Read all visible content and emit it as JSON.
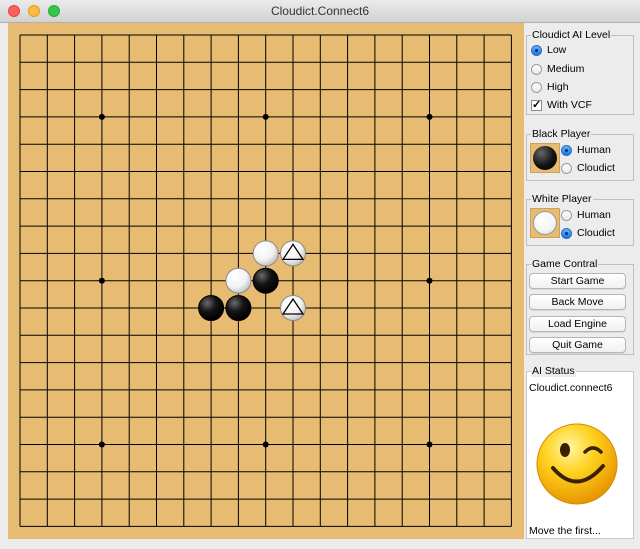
{
  "window": {
    "title": "Cloudict.Connect6"
  },
  "board": {
    "grid_size": 19,
    "star_points": [
      [
        3,
        3
      ],
      [
        9,
        3
      ],
      [
        15,
        3
      ],
      [
        3,
        9
      ],
      [
        15,
        9
      ],
      [
        3,
        15
      ],
      [
        9,
        15
      ],
      [
        15,
        15
      ]
    ],
    "stones": [
      {
        "col": 9,
        "row": 8,
        "color": "white",
        "marker": ""
      },
      {
        "col": 10,
        "row": 8,
        "color": "white",
        "marker": "triangle"
      },
      {
        "col": 8,
        "row": 9,
        "color": "white",
        "marker": ""
      },
      {
        "col": 9,
        "row": 9,
        "color": "black",
        "marker": ""
      },
      {
        "col": 7,
        "row": 10,
        "color": "black",
        "marker": ""
      },
      {
        "col": 8,
        "row": 10,
        "color": "black",
        "marker": ""
      },
      {
        "col": 10,
        "row": 10,
        "color": "white",
        "marker": "triangle"
      }
    ],
    "colors": {
      "board": "#e7bb72",
      "line": "#000000"
    }
  },
  "ai_level": {
    "title": "Cloudict AI Level",
    "options": [
      "Low",
      "Medium",
      "High"
    ],
    "selected": "Low",
    "vcf_label": "With VCF",
    "vcf_checked": true
  },
  "black_player": {
    "title": "Black Player",
    "options": [
      "Human",
      "Cloudict"
    ],
    "selected": "Human"
  },
  "white_player": {
    "title": "White Player",
    "options": [
      "Human",
      "Cloudict"
    ],
    "selected": "Cloudict"
  },
  "game_control": {
    "title": "Game Contral",
    "buttons": [
      "Start Game",
      "Back Move",
      "Load Engine",
      "Quit Game"
    ]
  },
  "ai_status": {
    "title": "AI Status",
    "engine": "Cloudict.connect6",
    "face_icon": "winking-smiley-icon",
    "message": "Move the first..."
  }
}
